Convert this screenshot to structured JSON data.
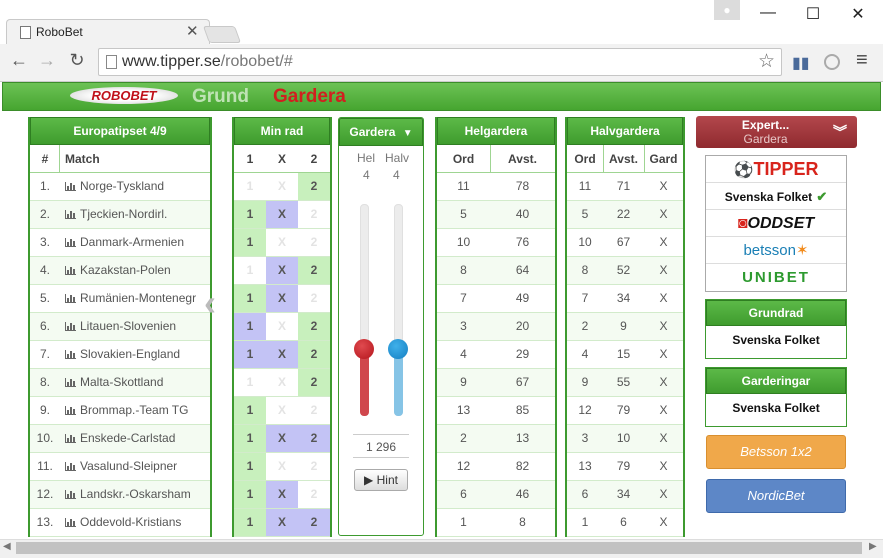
{
  "browser": {
    "tab_title": "RoboBet",
    "url_host": "www.tipper.se",
    "url_path": "/robobet/#",
    "icons": {
      "back": "←",
      "forward": "→",
      "reload": "↻",
      "star": "☆",
      "close": "✕",
      "minimize": "—",
      "maximize": "☐",
      "menu": "≡"
    }
  },
  "header": {
    "logo": "ROBOBET",
    "nav_grund": "Grund",
    "nav_gardera": "Gardera"
  },
  "matches_panel": {
    "title": "Europatipset 4/9",
    "col_num": "#",
    "col_match": "Match",
    "rows": [
      {
        "num": "1.",
        "name": "Norge-Tyskland"
      },
      {
        "num": "2.",
        "name": "Tjeckien-Nordirl."
      },
      {
        "num": "3.",
        "name": "Danmark-Armenien"
      },
      {
        "num": "4.",
        "name": "Kazakstan-Polen"
      },
      {
        "num": "5.",
        "name": "Rumänien-Montenegr"
      },
      {
        "num": "6.",
        "name": "Litauen-Slovenien"
      },
      {
        "num": "7.",
        "name": "Slovakien-England"
      },
      {
        "num": "8.",
        "name": "Malta-Skottland"
      },
      {
        "num": "9.",
        "name": "Brommap.-Team TG"
      },
      {
        "num": "10.",
        "name": "Enskede-Carlstad"
      },
      {
        "num": "11.",
        "name": "Vasalund-Sleipner"
      },
      {
        "num": "12.",
        "name": "Landskr.-Oskarsham"
      },
      {
        "num": "13.",
        "name": "Oddevold-Kristians"
      }
    ]
  },
  "minrad_panel": {
    "title": "Min rad",
    "cols": [
      "1",
      "X",
      "2"
    ],
    "picks": [
      [
        0,
        0,
        1
      ],
      [
        1,
        2,
        0
      ],
      [
        1,
        0,
        0
      ],
      [
        0,
        2,
        1
      ],
      [
        1,
        2,
        0
      ],
      [
        3,
        0,
        1
      ],
      [
        3,
        2,
        1
      ],
      [
        0,
        0,
        1
      ],
      [
        1,
        0,
        0
      ],
      [
        1,
        2,
        3
      ],
      [
        1,
        0,
        0
      ],
      [
        1,
        2,
        0
      ],
      [
        1,
        2,
        3
      ]
    ]
  },
  "gardera_panel": {
    "title": "Gardera",
    "hel_label": "Hel",
    "halv_label": "Halv",
    "hel_value": "4",
    "halv_value": "4",
    "total": "1 296",
    "hint_label": "▶ Hint",
    "hel_color": "#c0222a",
    "halv_color": "#1e8fd0"
  },
  "helgardera_panel": {
    "title": "Helgardera",
    "col_ord": "Ord",
    "col_avst": "Avst.",
    "rows": [
      [
        "11",
        "78"
      ],
      [
        "5",
        "40"
      ],
      [
        "10",
        "76"
      ],
      [
        "8",
        "64"
      ],
      [
        "7",
        "49"
      ],
      [
        "3",
        "20"
      ],
      [
        "4",
        "29"
      ],
      [
        "9",
        "67"
      ],
      [
        "13",
        "85"
      ],
      [
        "2",
        "13"
      ],
      [
        "12",
        "82"
      ],
      [
        "6",
        "46"
      ],
      [
        "1",
        "8"
      ]
    ]
  },
  "halvgardera_panel": {
    "title": "Halvgardera",
    "col_ord": "Ord",
    "col_avst": "Avst.",
    "col_gard": "Gard",
    "rows": [
      [
        "11",
        "71",
        "X"
      ],
      [
        "5",
        "22",
        "X"
      ],
      [
        "10",
        "67",
        "X"
      ],
      [
        "8",
        "52",
        "X"
      ],
      [
        "7",
        "34",
        "X"
      ],
      [
        "2",
        "9",
        "X"
      ],
      [
        "4",
        "15",
        "X"
      ],
      [
        "9",
        "55",
        "X"
      ],
      [
        "12",
        "79",
        "X"
      ],
      [
        "3",
        "10",
        "X"
      ],
      [
        "13",
        "79",
        "X"
      ],
      [
        "6",
        "34",
        "X"
      ],
      [
        "1",
        "6",
        "X"
      ]
    ]
  },
  "right_panel": {
    "expert_title": "Expert...",
    "expert_sub": "Gardera",
    "brands": [
      "TIPPER",
      "Svenska Folket",
      "ODDSET",
      "betsson",
      "UNIBET"
    ],
    "selected_check": "✔",
    "grundrad_title": "Grundrad",
    "grundrad_value": "Svenska Folket",
    "garderingar_title": "Garderingar",
    "garderingar_value": "Svenska Folket",
    "betsson_button": "Betsson 1x2",
    "nordicbet_button": "NordicBet"
  },
  "colors": {
    "green": "#46a530",
    "pick1": "#c8f0bd",
    "pickx": "#c3c3f5",
    "betsson_btn": "#f0a84a",
    "nordicbet_btn": "#5d87c7",
    "expert": "#a53a3f"
  }
}
